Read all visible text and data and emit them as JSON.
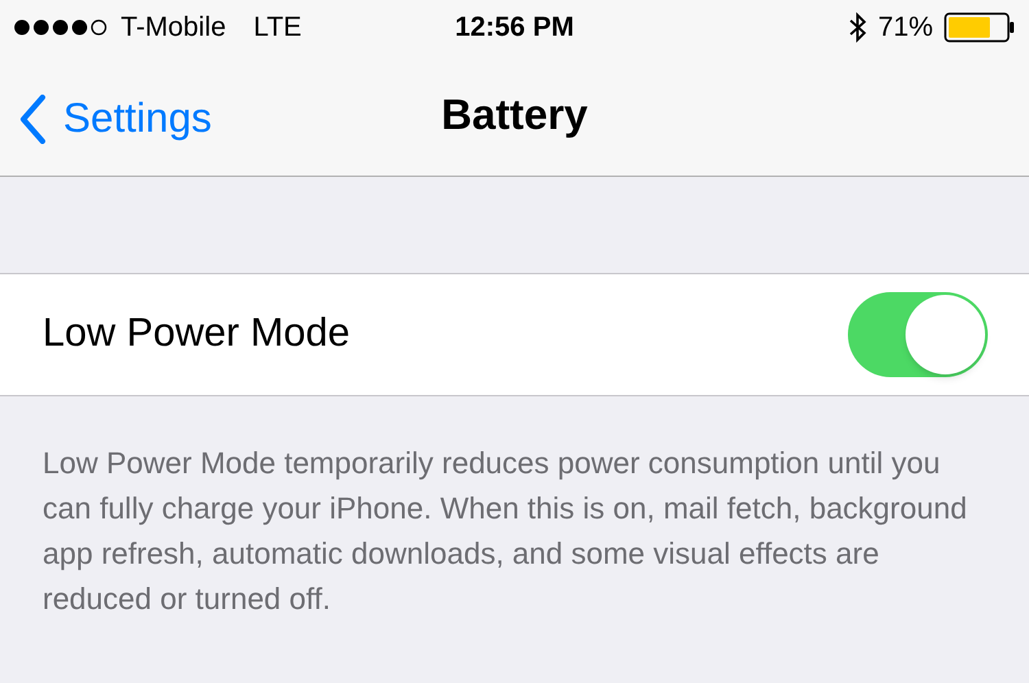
{
  "status_bar": {
    "carrier": "T-Mobile",
    "network": "LTE",
    "time": "12:56 PM",
    "battery_percent": "71%"
  },
  "nav_bar": {
    "back": "Settings",
    "title": "Battery"
  },
  "settings": [
    {
      "label": "Low Power Mode",
      "on": true
    }
  ],
  "footer": "Low Power Mode temporarily reduces power consumption until you can fully charge your iPhone. When this is on, mail fetch, background app refresh, automatic downloads, and some visual effects are reduced or turned off."
}
